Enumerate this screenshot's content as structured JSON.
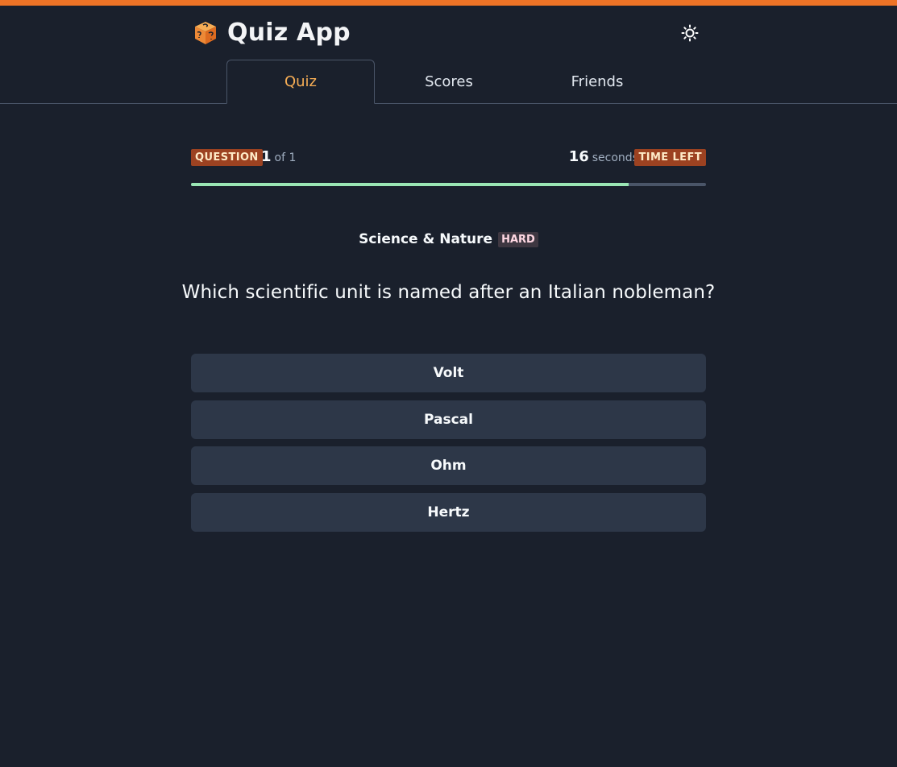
{
  "header": {
    "app_title": "Quiz App",
    "logo_icon": "dice-icon",
    "theme_toggle_icon": "sun-icon",
    "accent_color": "#ed7326"
  },
  "tabs": [
    {
      "label": "Quiz",
      "active": true
    },
    {
      "label": "Scores",
      "active": false
    },
    {
      "label": "Friends",
      "active": false
    }
  ],
  "question_status": {
    "badge": "QUESTION",
    "current": "1",
    "of_total": "of 1"
  },
  "timer": {
    "seconds": "16",
    "unit": "seconds",
    "badge": "TIME LEFT",
    "progress_fraction": 0.85
  },
  "question": {
    "category": "Science & Nature",
    "difficulty": "HARD",
    "text": "Which scientific unit is named after an Italian nobleman?"
  },
  "answers": [
    "Volt",
    "Pascal",
    "Ohm",
    "Hertz"
  ]
}
